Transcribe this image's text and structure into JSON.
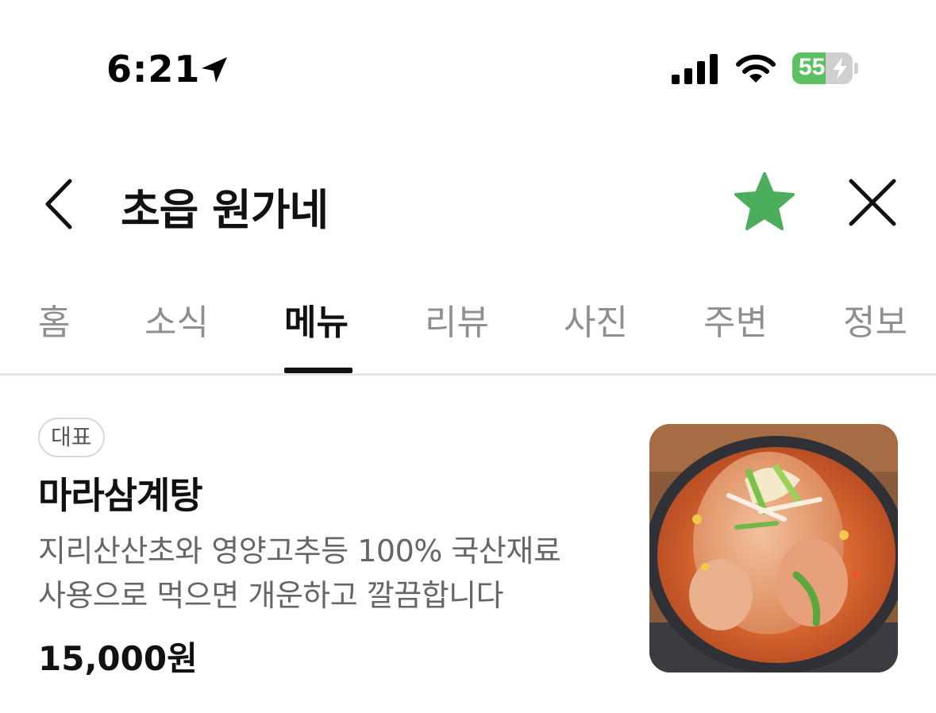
{
  "status_bar": {
    "time": "6:21",
    "battery_percent": "55",
    "battery_level": 0.55,
    "icons": [
      "location-arrow-icon",
      "cellular-signal-icon",
      "wifi-icon",
      "battery-charging-icon"
    ]
  },
  "header": {
    "title": "초읍 원가네",
    "back_icon": "chevron-left-icon",
    "favorite_icon": "star-icon",
    "close_icon": "close-icon",
    "favorite_color": "#4cad5d"
  },
  "tabs": [
    {
      "label": "홈",
      "active": false
    },
    {
      "label": "소식",
      "active": false
    },
    {
      "label": "메뉴",
      "active": true
    },
    {
      "label": "리뷰",
      "active": false
    },
    {
      "label": "사진",
      "active": false
    },
    {
      "label": "주변",
      "active": false
    },
    {
      "label": "정보",
      "active": false
    }
  ],
  "menu": {
    "items": [
      {
        "badge": "대표",
        "name": "마라삼계탕",
        "description_line1": "지리산산초와 영양고추등 100% 국산재료",
        "description_line2": "사용으로 먹으면 개운하고 깔끔합니다",
        "price": "15,000원"
      }
    ]
  }
}
